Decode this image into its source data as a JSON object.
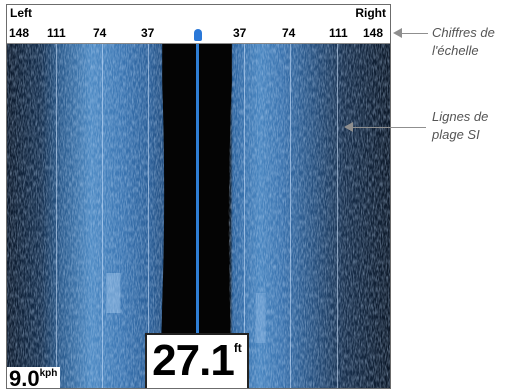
{
  "scale": {
    "left_label": "Left",
    "right_label": "Right",
    "ticks": [
      "148",
      "111",
      "74",
      "37",
      "37",
      "74",
      "111",
      "148"
    ]
  },
  "depth": {
    "value": "27.1",
    "unit": "ft"
  },
  "speed": {
    "value": "9.0",
    "unit": "kph"
  },
  "callouts": {
    "scale_digits": {
      "line1": "Chiffres de",
      "line2": "l'échelle"
    },
    "range_lines": {
      "line1": "Lignes de",
      "line2": "plage SI"
    }
  },
  "colors": {
    "center_line": "#2f7fd6",
    "water_column": "#050505",
    "sonar_blue": "#3f7fc0"
  }
}
